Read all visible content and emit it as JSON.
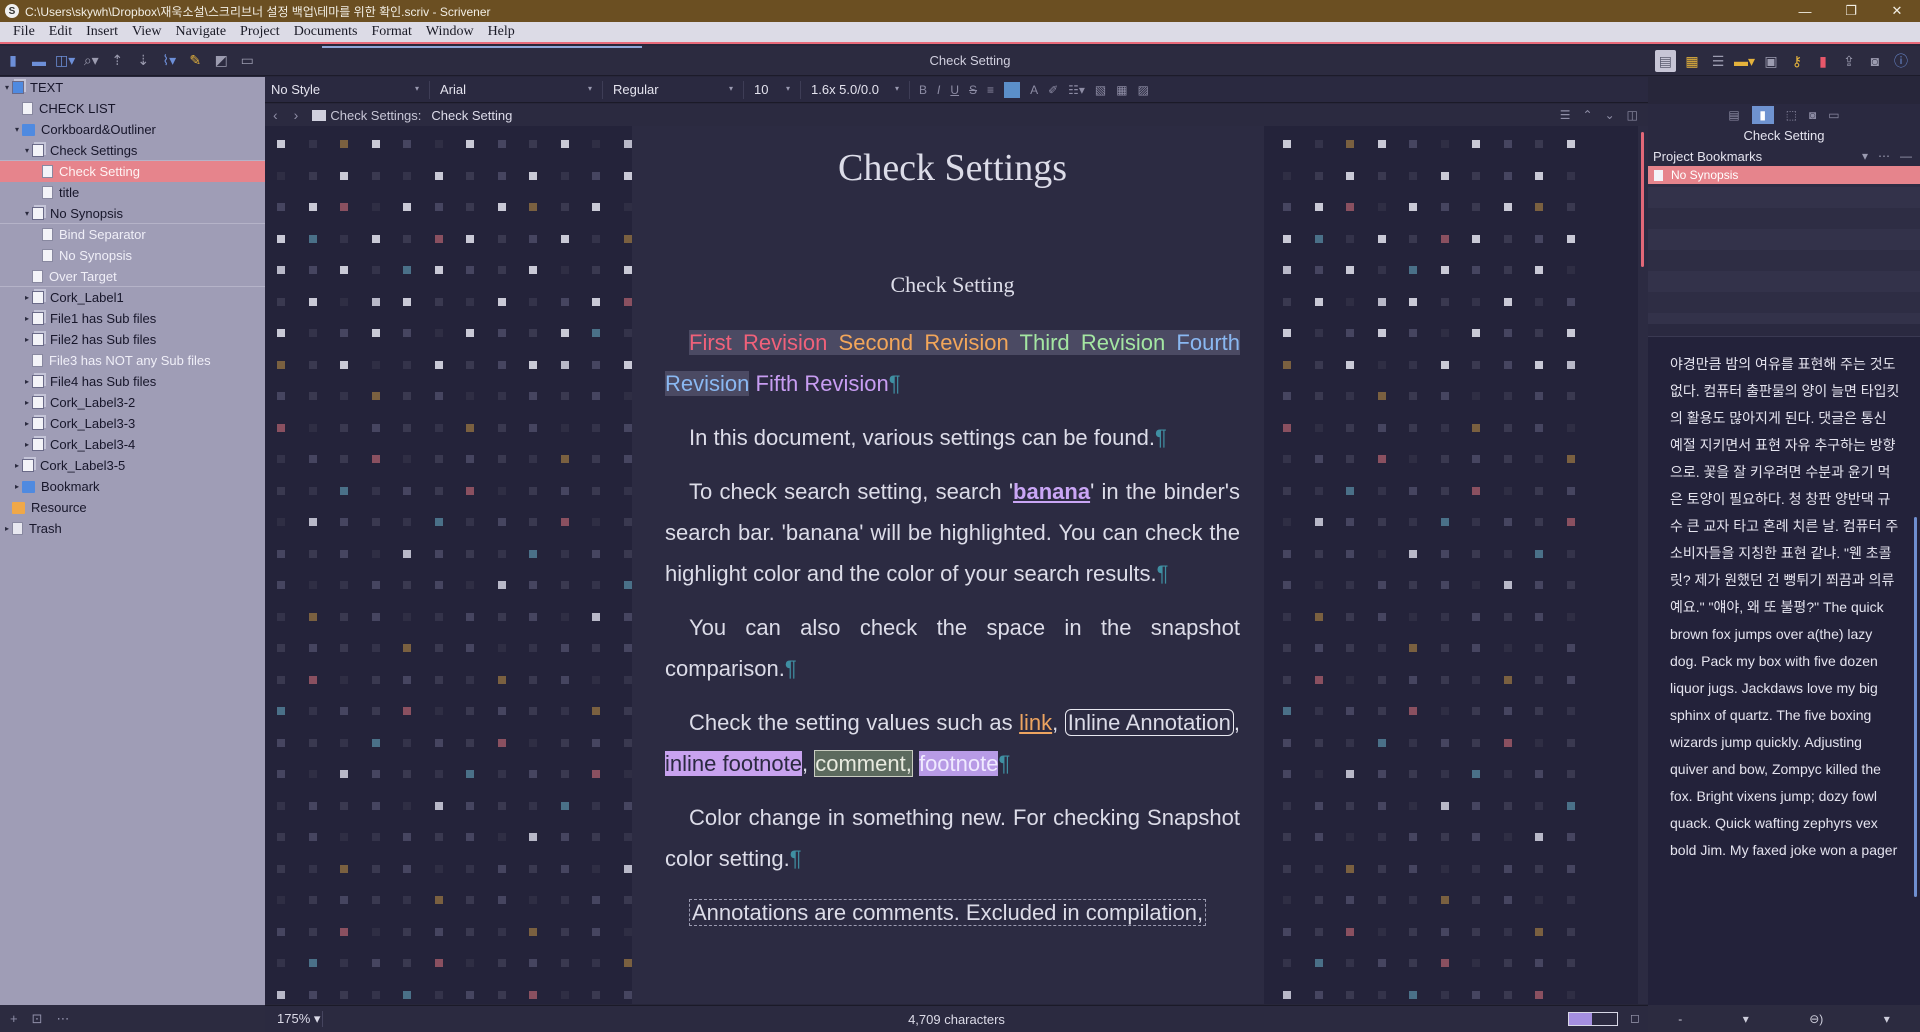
{
  "window": {
    "title": "C:\\Users\\skywh\\Dropbox\\재욱소설\\스크리브너 설정 백업\\테마를 위한 확인.scriv - Scrivener",
    "minimize": "—",
    "maximize": "❐",
    "close": "✕"
  },
  "menu": {
    "items": [
      {
        "label": "File"
      },
      {
        "label": "Edit"
      },
      {
        "label": "Insert"
      },
      {
        "label": "View"
      },
      {
        "label": "Navigate"
      },
      {
        "label": "Project"
      },
      {
        "label": "Documents"
      },
      {
        "label": "Format"
      },
      {
        "label": "Window"
      },
      {
        "label": "Help"
      }
    ]
  },
  "toolbar": {
    "document_title": "Check Setting"
  },
  "binder": {
    "items": [
      {
        "label": "TEXT",
        "level": 0,
        "arrow": "▾",
        "icon": "stack"
      },
      {
        "label": "CHECK LIST",
        "level": 1,
        "arrow": "",
        "icon": "doc"
      },
      {
        "label": "Corkboard&Outliner",
        "level": 1,
        "arrow": "▾",
        "icon": "folder"
      },
      {
        "label": "Check Settings",
        "level": 2,
        "arrow": "▾",
        "icon": "stack"
      },
      {
        "label": "Check Setting",
        "level": 3,
        "arrow": "",
        "icon": "doc",
        "state": "selected"
      },
      {
        "label": "title",
        "level": 3,
        "arrow": "",
        "icon": "doc"
      },
      {
        "label": "No Synopsis",
        "level": 2,
        "arrow": "▾",
        "icon": "stack"
      },
      {
        "label": "Bind Separator",
        "level": 3,
        "arrow": "",
        "icon": "doc",
        "state": "dimmed"
      },
      {
        "label": "No Synopsis",
        "level": 3,
        "arrow": "",
        "icon": "doc",
        "state": "dimmed"
      },
      {
        "label": "Over Target",
        "level": 2,
        "arrow": "",
        "icon": "doc",
        "state": "dimmed"
      },
      {
        "label": "Cork_Label1",
        "level": 2,
        "arrow": "▸",
        "icon": "stack"
      },
      {
        "label": "File1 has Sub files",
        "level": 2,
        "arrow": "▸",
        "icon": "stack"
      },
      {
        "label": "File2 has Sub files",
        "level": 2,
        "arrow": "▸",
        "icon": "stack"
      },
      {
        "label": "File3 has NOT any Sub files",
        "level": 2,
        "arrow": "",
        "icon": "doc",
        "state": "dimmed"
      },
      {
        "label": "File4 has Sub files",
        "level": 2,
        "arrow": "▸",
        "icon": "stack"
      },
      {
        "label": "Cork_Label3-2",
        "level": 2,
        "arrow": "▸",
        "icon": "stack"
      },
      {
        "label": "Cork_Label3-3",
        "level": 2,
        "arrow": "▸",
        "icon": "stack"
      },
      {
        "label": "Cork_Label3-4",
        "level": 2,
        "arrow": "▸",
        "icon": "stack"
      },
      {
        "label": "Cork_Label3-5",
        "level": 1,
        "arrow": "▸",
        "icon": "stack"
      },
      {
        "label": "Bookmark",
        "level": 1,
        "arrow": "▸",
        "icon": "folder"
      },
      {
        "label": "Resource",
        "level": 0,
        "arrow": "",
        "icon": "folder"
      },
      {
        "label": "Trash",
        "level": 0,
        "arrow": "▸",
        "icon": "trash"
      }
    ],
    "footer": {
      "add": "+",
      "new_folder": "⊡",
      "more": "⋯"
    }
  },
  "formatbar": {
    "style": "No Style",
    "font": "Arial",
    "weight": "Regular",
    "size": "10",
    "spacing": "1.6x 5.0/0.0"
  },
  "header": {
    "crumb_parent": "Check Settings:",
    "crumb_doc": "Check Setting"
  },
  "editor": {
    "title": "Check Settings",
    "subtitle": "Check Setting",
    "revisions": {
      "r1": "First Revision",
      "r2": "Second Revision",
      "r3": "Third Revision",
      "r4": "Fourth Revision",
      "r5": "Fifth Revision"
    },
    "p2": "In this document, various settings can be found.",
    "p3_a": "To check search setting, search '",
    "p3_link": "banana",
    "p3_b": "' in the binder's search bar. 'banana' will be highlighted. You can check the highlight color and the color of your search results.",
    "p4": "You can also check the space in the snapshot comparison.",
    "p5_a": "Check the setting values such as ",
    "p5_link": "link",
    "p5_inline": "Inline Annotation",
    "p5_fn": "inline footnote",
    "p5_comment": "comment,",
    "p5_footnote": "footnote",
    "p6": "Color change in something new. For checking Snapshot color setting.",
    "p7": "Annotations are comments. Excluded in compilation,",
    "pilcrow": "¶",
    "colors": {
      "revision1": "#f0617a",
      "revision2": "#f2a65a",
      "revision3": "#a4e6a2",
      "revision4": "#8ab8f2",
      "revision5": "#c89df2",
      "link": "#eda460"
    }
  },
  "inspector": {
    "title": "Check Setting",
    "bookmarks_label": "Project Bookmarks",
    "bookmark_item": "No Synopsis",
    "notes": "야경만큼 밤의 여유를 표현해 주는 것도 없다. 컴퓨터 출판물의 양이 늘면 타입킷의 활용도 많아지게 된다. 댓글은 통신 예절 지키면서 표현 자유 추구하는 방향으로. 꽃을 잘 키우려면 수분과 윤기 먹은 토양이 필요하다. 청 창판 양반댁 규수 큰 교자 타고 혼례 치른 날. 컴퓨터 주 소비자들을 지칭한 표현 같냐. \"웬 초콜릿? 제가 원했던 건 뻥튀기 쬐끔과 의류예요.\" \"얘야, 왜 또 불평?\" The quick brown fox jumps over a(the) lazy dog. Pack my box with five dozen liquor jugs. Jackdaws love my big sphinx of quartz. The five boxing wizards jump quickly. Adjusting quiver and bow, Zompyc killed the fox. Bright vixens jump; dozy fowl quack. Quick wafting zephyrs vex bold Jim. My faxed joke won a pager"
  },
  "footer": {
    "zoom": "175%",
    "count": "4,709 characters",
    "target_fraction": 0.48
  },
  "inspector_footer": {
    "minus": "-",
    "dropdown": "▾",
    "link": "⊖)",
    "more": "▾"
  }
}
